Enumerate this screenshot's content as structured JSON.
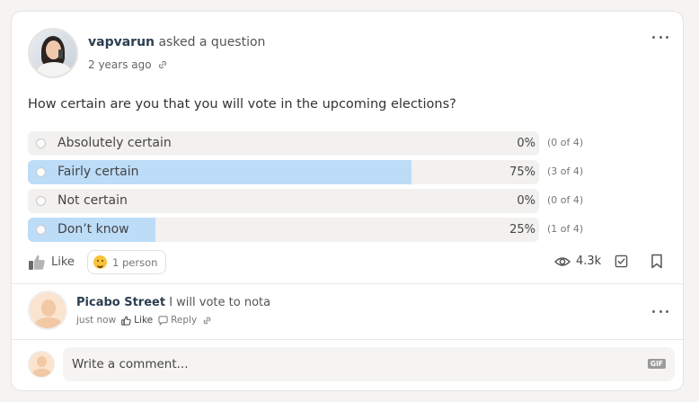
{
  "post": {
    "author": "vapvarun",
    "action": "asked a question",
    "time": "2 years ago",
    "question": "How certain are you that you will vote in the upcoming elections?",
    "options": [
      {
        "label": "Absolutely certain",
        "percent": 0,
        "percent_text": "0%",
        "count_text": "(0 of 4)"
      },
      {
        "label": "Fairly certain",
        "percent": 75,
        "percent_text": "75%",
        "count_text": "(3 of 4)"
      },
      {
        "label": "Not certain",
        "percent": 0,
        "percent_text": "0%",
        "count_text": "(0 of 4)"
      },
      {
        "label": "Don’t know",
        "percent": 25,
        "percent_text": "25%",
        "count_text": "(1 of 4)"
      }
    ],
    "like_label": "Like",
    "reaction_text": "1 person",
    "views": "4.3k"
  },
  "reply": {
    "name": "Picabo Street",
    "text": "I will vote to nota",
    "time": "just now",
    "like_label": "Like",
    "reply_label": "Reply"
  },
  "composer": {
    "placeholder": "Write a comment...",
    "gif_label": "GIF"
  },
  "colors": {
    "bar_fill": "#bcdcf8",
    "bar_track": "#f2f1ef",
    "name": "#2c3e50"
  }
}
